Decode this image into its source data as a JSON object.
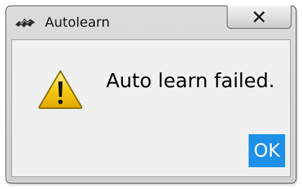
{
  "window": {
    "title": "Autolearn",
    "app_icon": "app-icon",
    "close_icon": "close-icon"
  },
  "dialog": {
    "icon": "warning-icon",
    "message": "Auto learn failed.",
    "ok_label": "OK"
  },
  "colors": {
    "ok_button": "#1e90e8",
    "warning_fill": "#f5cc14",
    "content_bg": "#f0f0f0"
  }
}
